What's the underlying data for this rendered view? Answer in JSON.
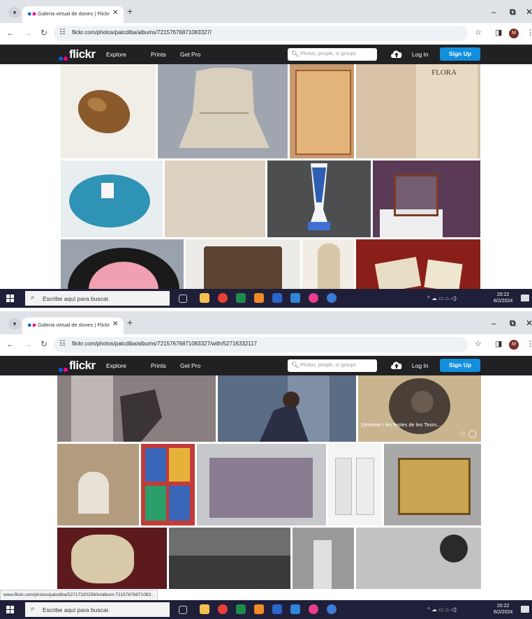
{
  "screenshot_1": {
    "browser": {
      "tab_title": "Galeria virtual de dones | Flickr",
      "url": "flickr.com/photos/patcdiba/albums/72157676871083327/"
    },
    "flickr": {
      "brand": "flickr",
      "nav": [
        "Explore",
        "Prints",
        "Get Pro"
      ],
      "search_placeholder": "Photos, people, or groups",
      "login": "Log In",
      "signup": "Sign Up"
    },
    "taskbar": {
      "search_placeholder": "Escribe aquí para buscar.",
      "time": "20:22",
      "date": "6/2/2024"
    }
  },
  "screenshot_2": {
    "browser": {
      "tab_title": "Galeria virtual de dones | Flickr",
      "url": "flickr.com/photos/patcdiba/albums/72157676871083327/with/52716332117"
    },
    "flickr": {
      "brand": "flickr",
      "nav": [
        "Explore",
        "Prints",
        "Get Pro"
      ],
      "search_placeholder": "Photos, people, or groups",
      "login": "Log In",
      "signup": "Sign Up"
    },
    "photo_caption": "Demeter i les festes de les Tesm...",
    "status_url": "www.flickr.com/photos/patcdiba/52717320258/in/album-72157676871083...",
    "taskbar": {
      "search_placeholder": "Escribe aquí para buscar.",
      "time": "20:22",
      "date": "6/2/2024"
    }
  },
  "colors": {
    "flickr_blue": "#0063dc",
    "flickr_pink": "#ff0084",
    "signup_button": "#128fdc",
    "header_bg": "#212124",
    "taskbar_bg": "#1f1f3a"
  }
}
